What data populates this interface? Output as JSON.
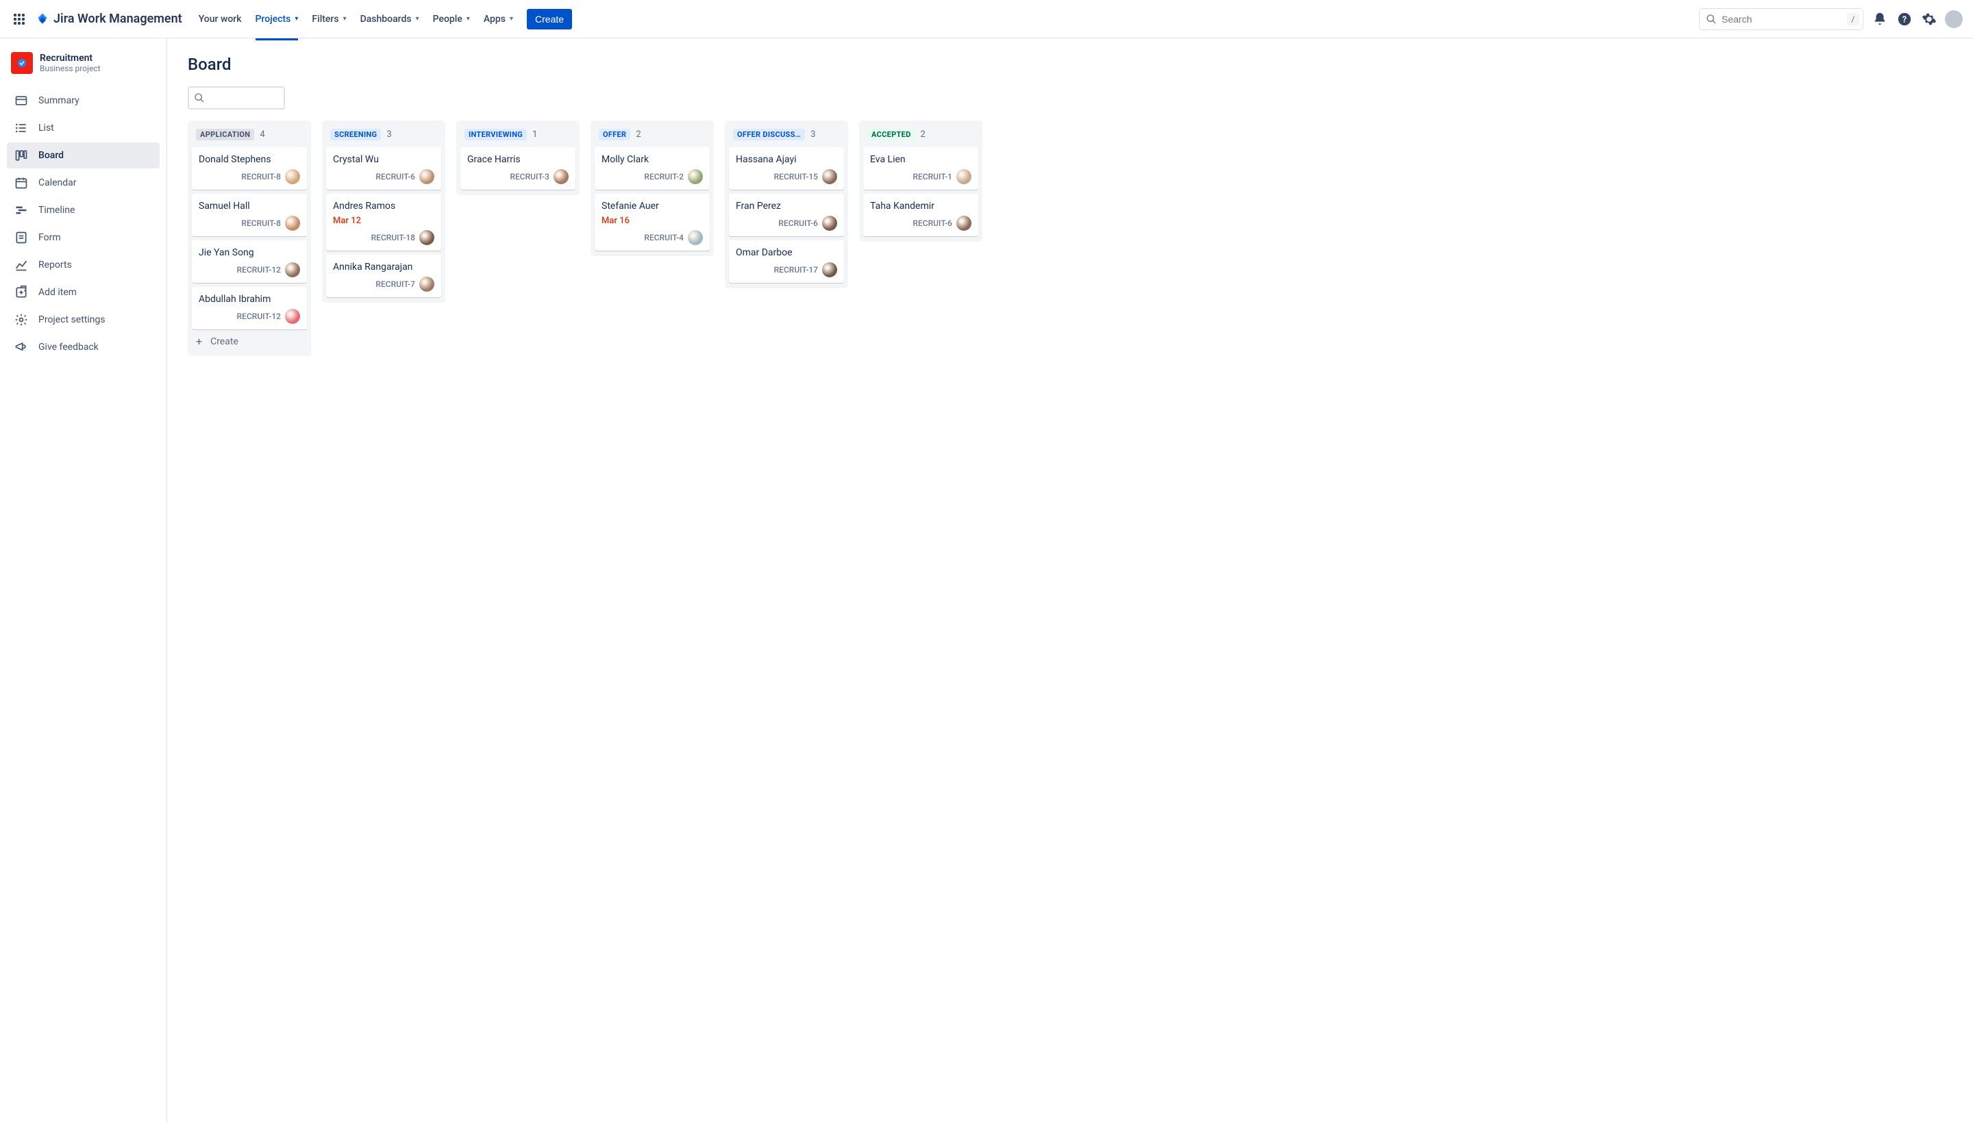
{
  "topbar": {
    "logo_text": "Jira Work Management",
    "nav": [
      {
        "label": "Your work",
        "dropdown": false,
        "active": false
      },
      {
        "label": "Projects",
        "dropdown": true,
        "active": true
      },
      {
        "label": "Filters",
        "dropdown": true,
        "active": false
      },
      {
        "label": "Dashboards",
        "dropdown": true,
        "active": false
      },
      {
        "label": "People",
        "dropdown": true,
        "active": false
      },
      {
        "label": "Apps",
        "dropdown": true,
        "active": false
      }
    ],
    "create_label": "Create",
    "search_placeholder": "Search",
    "search_shortcut": "/"
  },
  "sidebar": {
    "project_name": "Recruitment",
    "project_type": "Business project",
    "items": [
      {
        "label": "Summary",
        "icon": "card-icon"
      },
      {
        "label": "List",
        "icon": "list-icon"
      },
      {
        "label": "Board",
        "icon": "board-icon"
      },
      {
        "label": "Calendar",
        "icon": "calendar-icon"
      },
      {
        "label": "Timeline",
        "icon": "timeline-icon"
      },
      {
        "label": "Form",
        "icon": "form-icon"
      },
      {
        "label": "Reports",
        "icon": "reports-icon"
      },
      {
        "label": "Add item",
        "icon": "add-item-icon"
      },
      {
        "label": "Project settings",
        "icon": "settings-icon"
      },
      {
        "label": "Give feedback",
        "icon": "feedback-icon"
      }
    ],
    "active_index": 2
  },
  "page": {
    "title": "Board",
    "create_card_label": "Create"
  },
  "columns": [
    {
      "title": "APPLICATION",
      "count": 4,
      "color": "gray",
      "show_create": true,
      "cards": [
        {
          "title": "Donald Stephens",
          "key": "RECRUIT-8",
          "avatar": "#d4a574"
        },
        {
          "title": "Samuel Hall",
          "key": "RECRUIT-8",
          "avatar": "#c48a65"
        },
        {
          "title": "Jie Yan Song",
          "key": "RECRUIT-12",
          "avatar": "#8b6f5c"
        },
        {
          "title": "Abdullah Ibrahim",
          "key": "RECRUIT-12",
          "avatar": "#e8667a"
        }
      ]
    },
    {
      "title": "SCREENING",
      "count": 3,
      "color": "blue",
      "cards": [
        {
          "title": "Crystal Wu",
          "key": "RECRUIT-6",
          "avatar": "#b89070"
        },
        {
          "title": "Andres Ramos",
          "date": "Mar 12",
          "key": "RECRUIT-18",
          "avatar": "#7a5c4a"
        },
        {
          "title": "Annika Rangarajan",
          "key": "RECRUIT-7",
          "avatar": "#9b7a6a"
        }
      ]
    },
    {
      "title": "INTERVIEWING",
      "count": 1,
      "color": "blue",
      "cards": [
        {
          "title": "Grace Harris",
          "key": "RECRUIT-3",
          "avatar": "#a67860"
        }
      ]
    },
    {
      "title": "OFFER",
      "count": 2,
      "color": "blue",
      "cards": [
        {
          "title": "Molly Clark",
          "key": "RECRUIT-2",
          "avatar": "#8fa676"
        },
        {
          "title": "Stefanie Auer",
          "date": "Mar 16",
          "key": "RECRUIT-4",
          "avatar": "#9eb8c4"
        }
      ]
    },
    {
      "title": "OFFER DISCUSS…",
      "count": 3,
      "color": "blue",
      "cards": [
        {
          "title": "Hassana Ajayi",
          "key": "RECRUIT-15",
          "avatar": "#8a6a5a"
        },
        {
          "title": "Fran Perez",
          "key": "RECRUIT-6",
          "avatar": "#7a5a4a"
        },
        {
          "title": "Omar Darboe",
          "key": "RECRUIT-17",
          "avatar": "#6a5a4a"
        }
      ]
    },
    {
      "title": "ACCEPTED",
      "count": 2,
      "color": "green",
      "cards": [
        {
          "title": "Eva Lien",
          "key": "RECRUIT-1",
          "avatar": "#c4a890"
        },
        {
          "title": "Taha Kandemir",
          "key": "RECRUIT-6",
          "avatar": "#8a6a5a"
        }
      ]
    }
  ]
}
